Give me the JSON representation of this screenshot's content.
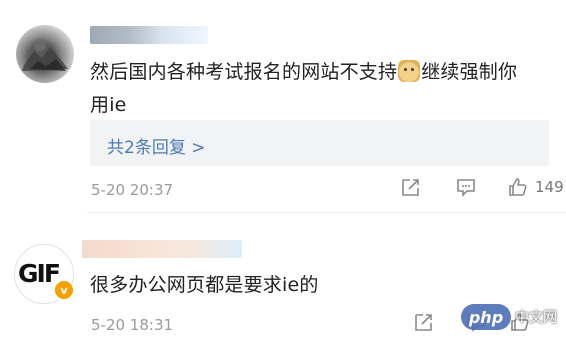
{
  "comments": [
    {
      "text_part1": "然后国内各种考试报名的网站不支持",
      "text_part2": "继续强制你",
      "text_line2": "用ie",
      "replies_link": "共2条回复 >",
      "time": "5-20 20:37",
      "like_count": "149"
    },
    {
      "avatar_text": "GIF",
      "text": "很多办公网页都是要求ie的",
      "time": "5-20 18:31"
    }
  ],
  "watermark": {
    "logo_text": "php",
    "text": "中文网"
  },
  "icons": {
    "share": "share-edit-icon",
    "comment": "comment-icon",
    "like": "thumbs-up-icon"
  },
  "colors": {
    "link": "#4a7bb7",
    "meta": "#9a9a9a",
    "badge": "#f6a100"
  }
}
